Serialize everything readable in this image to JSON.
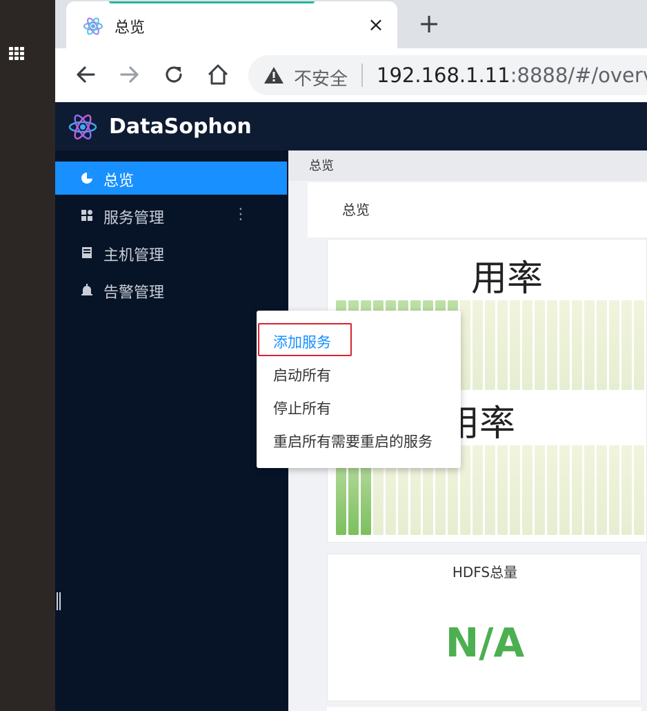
{
  "browser": {
    "tab": {
      "title": "总览",
      "close_label": "×"
    },
    "newtab_label": "+",
    "omnibox": {
      "security_text": "不安全",
      "url_host": "192.168.1.11",
      "url_rest": ":8888/#/overview"
    }
  },
  "app": {
    "brand": "DataSophon",
    "sidebar": {
      "items": [
        {
          "label": "总览",
          "icon": "pie-chart-icon",
          "active": true
        },
        {
          "label": "服务管理",
          "icon": "appstore-icon",
          "active": false
        },
        {
          "label": "主机管理",
          "icon": "server-icon",
          "active": false
        },
        {
          "label": "告警管理",
          "icon": "alarm-icon",
          "active": false
        }
      ],
      "kebab": "⋮"
    },
    "breadcrumb": "总览",
    "card_title": "总览",
    "usage": {
      "memory_title": "用率",
      "disk_title": "磁盘使用率"
    },
    "hdfs": {
      "title": "HDFS总量",
      "value": "N/A"
    },
    "dropdown": {
      "items": [
        "添加服务",
        "启动所有",
        "停止所有",
        "重启所有需要重启的服务"
      ]
    }
  },
  "colors": {
    "header_bg": "#0e1c33",
    "sidebar_bg": "#071428",
    "active_item": "#1890ff",
    "hdfs_value": "#4caf50",
    "highlight_border": "#d9232d"
  }
}
